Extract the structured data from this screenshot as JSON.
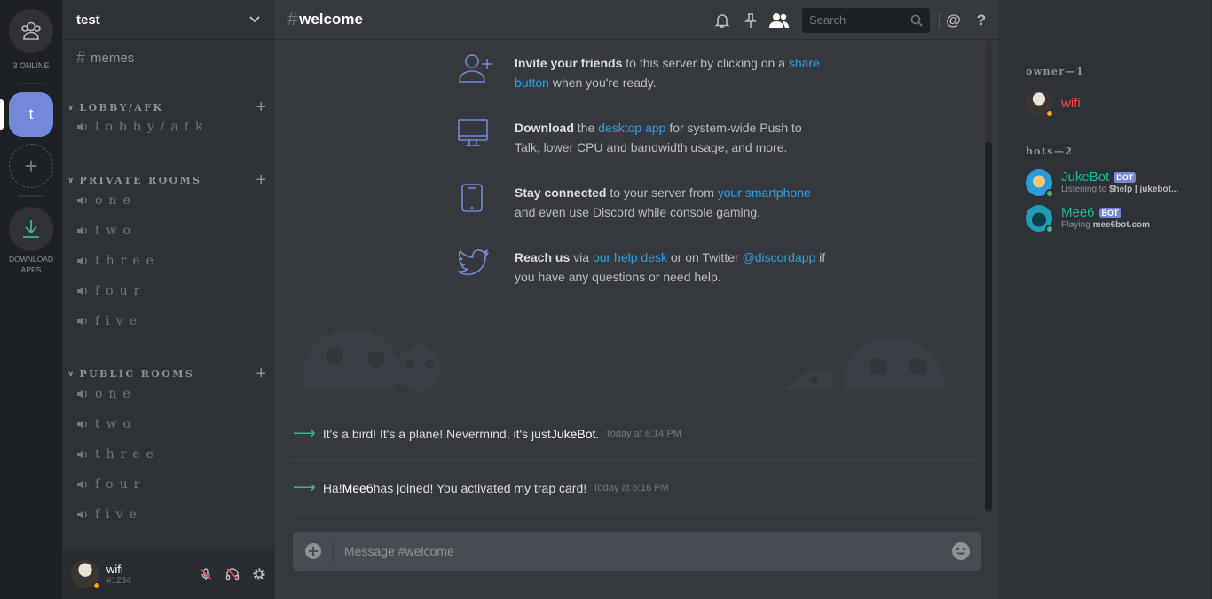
{
  "colors": {
    "accent": "#7289da",
    "online": "#43b581",
    "idle": "#faa61a",
    "link": "#2ea0e0",
    "owner_name": "#f04747",
    "bot_name": "#1abc9c"
  },
  "rail": {
    "online_label": "3 ONLINE",
    "server_initial": "t",
    "download_label_line1": "DOWNLOAD",
    "download_label_line2": "APPS"
  },
  "guild": {
    "name": "test"
  },
  "channels": {
    "text": [
      {
        "name": "memes"
      }
    ],
    "categories": [
      {
        "name": "LOBBY/AFK",
        "voice": [
          "lobby/afk"
        ]
      },
      {
        "name": "PRIVATE ROOMS",
        "voice": [
          "one",
          "two",
          "three",
          "four",
          "five"
        ]
      },
      {
        "name": "PUBLIC ROOMS",
        "voice": [
          "one",
          "two",
          "three",
          "four",
          "five"
        ]
      }
    ]
  },
  "user": {
    "name": "wifi",
    "tag": "#1234",
    "status": "idle"
  },
  "chat": {
    "channel": "welcome",
    "search_placeholder": "Search",
    "composer_placeholder": "Message #welcome",
    "tips": [
      {
        "icon": "add-friend-icon",
        "b": "Invite your friends",
        "t1": " to this server by clicking on a ",
        "link": "share button",
        "t2": " when you're ready."
      },
      {
        "icon": "desktop-icon",
        "b": "Download",
        "t1": " the ",
        "link": "desktop app",
        "t2": " for system-wide Push to Talk, lower CPU and bandwidth usage, and more."
      },
      {
        "icon": "smartphone-icon",
        "b": "Stay connected",
        "t1": " to your server from ",
        "link": "your smartphone",
        "t2": " and even use Discord while console gaming."
      },
      {
        "icon": "twitter-icon",
        "b": "Reach us",
        "t1": " via ",
        "link": "our help desk",
        "t2": " or on Twitter ",
        "link2": "@discordapp",
        "t3": " if you have any questions or need help."
      }
    ],
    "messages": [
      {
        "pre": "It's a bird! It's a plane! Nevermind, it's just ",
        "user": "JukeBot",
        "post": ".",
        "time": "Today at 6:14 PM"
      },
      {
        "pre": "Ha! ",
        "user": "Mee6",
        "post": " has joined! You activated my trap card!",
        "time": "Today at 6:16 PM"
      }
    ]
  },
  "members": {
    "groups": [
      {
        "title": "owner—1",
        "items": [
          {
            "name": "wifi",
            "status": "idle"
          }
        ]
      },
      {
        "title": "bots—2",
        "items": [
          {
            "name": "JukeBot",
            "badge": "BOT",
            "activity_prefix": "Listening to ",
            "activity": "$help | jukebot...",
            "status": "online"
          },
          {
            "name": "Mee6",
            "badge": "BOT",
            "activity_prefix": "Playing ",
            "activity": "mee6bot.com",
            "status": "online"
          }
        ]
      }
    ]
  }
}
